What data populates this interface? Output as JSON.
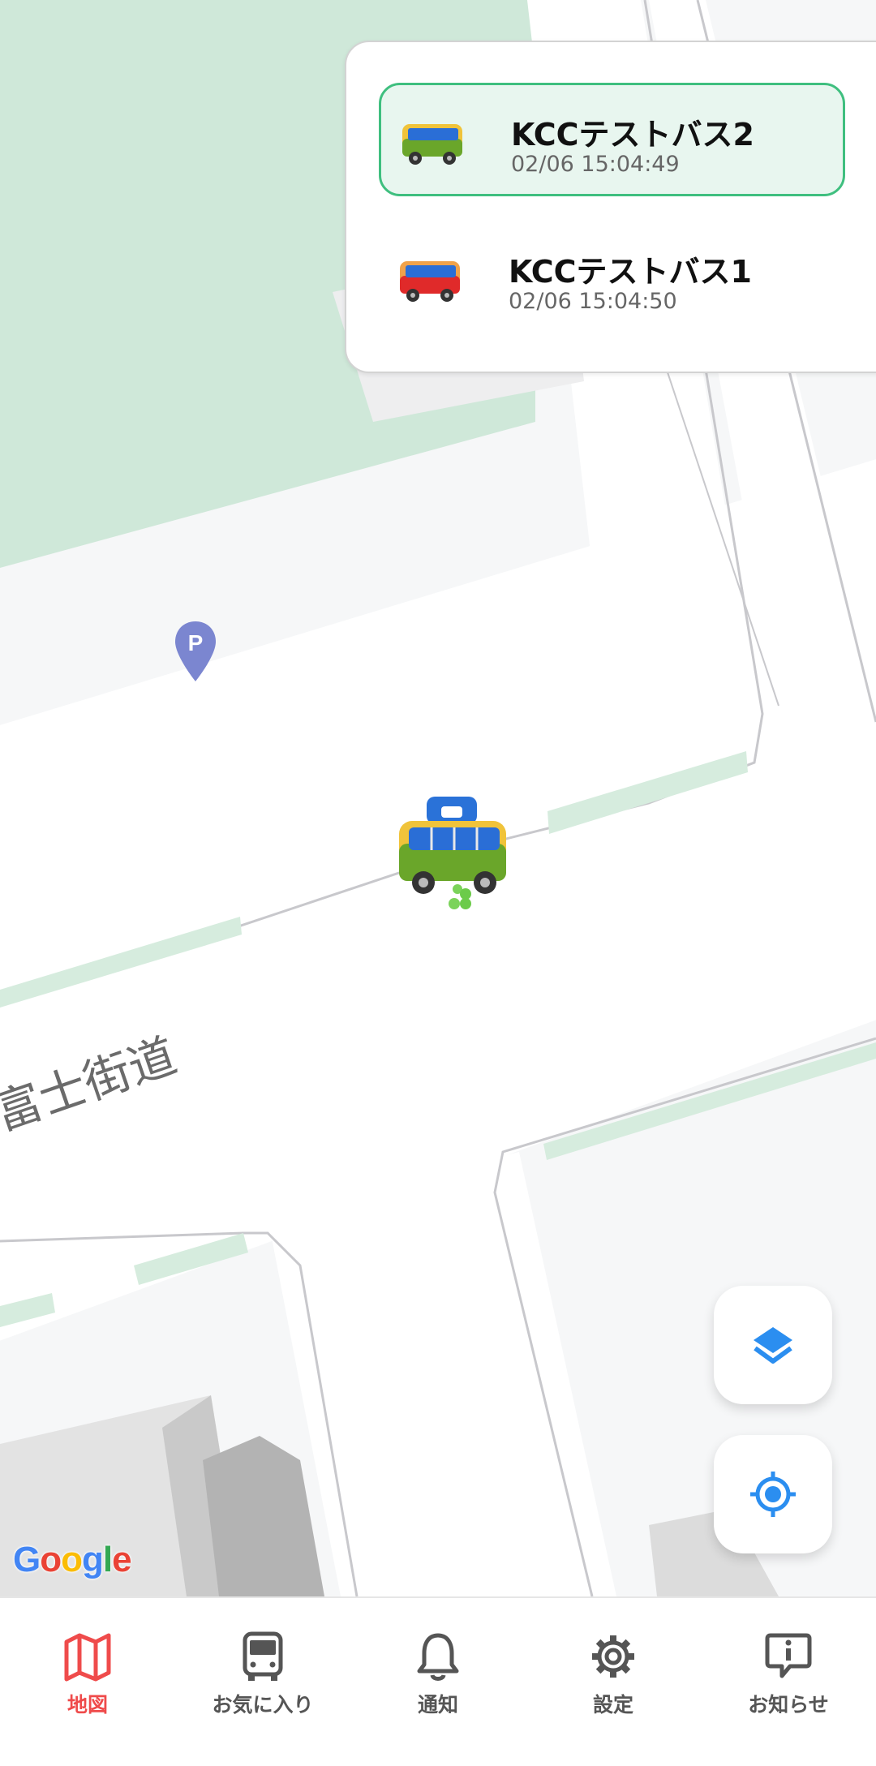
{
  "map": {
    "street_name": "富士街道",
    "attribution": "Google",
    "layers_button_icon": "layers-icon",
    "locate_button_icon": "my-location-icon",
    "parking_icon": "parking-pin-icon",
    "bus_marker_icon": "bus-stop-marker-icon"
  },
  "bus_list": [
    {
      "name": "KCCテストバス2",
      "timestamp": "02/06 15:04:49",
      "color": "green",
      "selected": true
    },
    {
      "name": "KCCテストバス1",
      "timestamp": "02/06 15:04:50",
      "color": "red",
      "selected": false
    }
  ],
  "colors": {
    "accent": "#2b8ef0",
    "active_tab": "#ef4b4b",
    "selected_row_bg": "#e8f6ef",
    "selected_row_border": "#3fbf7f",
    "park": "#cfe8d9"
  },
  "bottom_nav": [
    {
      "label": "地図",
      "icon": "map-icon",
      "active": true
    },
    {
      "label": "お気に入り",
      "icon": "bus-icon",
      "active": false
    },
    {
      "label": "通知",
      "icon": "bell-icon",
      "active": false
    },
    {
      "label": "設定",
      "icon": "gear-icon",
      "active": false
    },
    {
      "label": "お知らせ",
      "icon": "info-message-icon",
      "active": false
    }
  ]
}
